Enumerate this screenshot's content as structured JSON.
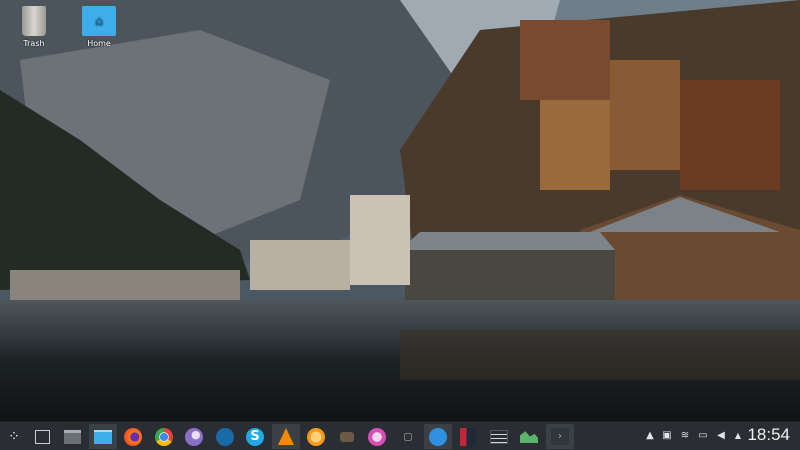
{
  "desktop": {
    "icons": [
      {
        "label": "Trash",
        "icon": "trash-icon"
      },
      {
        "label": "Home",
        "icon": "home-folder-icon"
      }
    ]
  },
  "taskbar": {
    "launchers": [
      {
        "name": "application-launcher",
        "icon": "kde-launcher-icon"
      },
      {
        "name": "show-desktop",
        "icon": "show-desktop-icon"
      },
      {
        "name": "window-switcher",
        "icon": "window-list-icon"
      },
      {
        "name": "dolphin",
        "icon": "file-manager-icon",
        "active": true
      },
      {
        "name": "firefox",
        "icon": "firefox-icon"
      },
      {
        "name": "chrome",
        "icon": "chrome-icon"
      },
      {
        "name": "discover",
        "icon": "discover-icon"
      },
      {
        "name": "steam",
        "icon": "steam-icon"
      },
      {
        "name": "skype",
        "icon": "skype-icon"
      },
      {
        "name": "vlc",
        "icon": "vlc-icon",
        "active": true
      },
      {
        "name": "orange-app",
        "icon": "orange-icon"
      },
      {
        "name": "gimp",
        "icon": "gimp-icon"
      },
      {
        "name": "pink-app",
        "icon": "pink-icon"
      },
      {
        "name": "small-app",
        "icon": "app-icon"
      },
      {
        "name": "network-app",
        "icon": "network-icon",
        "active": true
      },
      {
        "name": "kdevelop",
        "icon": "ide-icon"
      },
      {
        "name": "settings-app",
        "icon": "sliders-icon"
      },
      {
        "name": "system-monitor",
        "icon": "system-monitor-icon"
      },
      {
        "name": "terminal",
        "icon": "terminal-icon",
        "active": true
      }
    ],
    "tray": [
      "vlc-tray-icon",
      "clipboard-icon",
      "wifi-icon",
      "battery-icon",
      "volume-icon",
      "expand-tray-icon"
    ],
    "clock": "18:54"
  },
  "colors": {
    "panel": "#2a2e32",
    "accent": "#3daee9"
  }
}
